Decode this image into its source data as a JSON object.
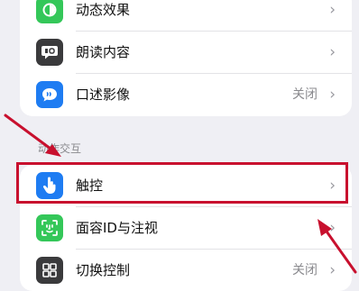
{
  "settings_top": {
    "items": [
      {
        "label": "动态效果",
        "icon": "motion-icon",
        "color": "#34c759"
      },
      {
        "label": "朗读内容",
        "icon": "speech-bubble-icon",
        "color": "#3a3a3c"
      },
      {
        "label": "口述影像",
        "icon": "audio-description-icon",
        "color": "#1e7cf2",
        "value": "关闭"
      }
    ]
  },
  "section": {
    "header": "动作交互"
  },
  "settings_bottom": {
    "items": [
      {
        "label": "触控",
        "icon": "touch-hand-icon",
        "color": "#1e7cf2"
      },
      {
        "label": "面容ID与注视",
        "icon": "face-id-icon",
        "color": "#34c759"
      },
      {
        "label": "切换控制",
        "icon": "switch-control-icon",
        "color": "#3a3a3c",
        "value": "关闭"
      }
    ]
  },
  "chevron": "›",
  "annotation": {
    "highlight_color": "#c8102e"
  }
}
